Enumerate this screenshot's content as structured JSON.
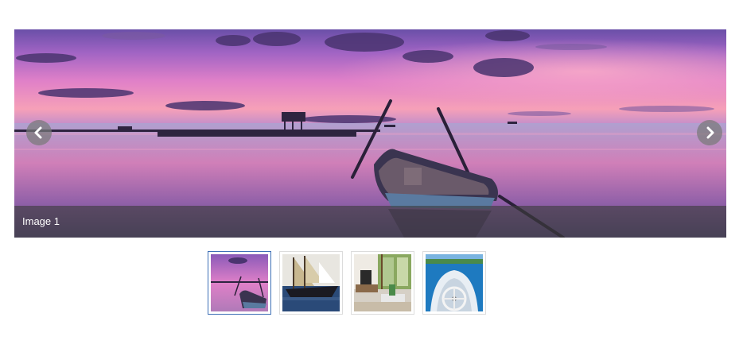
{
  "slider": {
    "caption": "Image 1",
    "prev_icon": "chevron-left-icon",
    "next_icon": "chevron-right-icon",
    "active_index": 0
  },
  "thumbnails": [
    {
      "subject": "sunset-boat",
      "active": true
    },
    {
      "subject": "sailing-ship",
      "active": false
    },
    {
      "subject": "living-room",
      "active": false
    },
    {
      "subject": "boat-deck-sea",
      "active": false
    }
  ],
  "colors": {
    "active_border": "#3d6fb6",
    "thumb_border": "#dcdcdc",
    "nav_button": "#787878",
    "caption_bar": "#3c3c3c"
  }
}
